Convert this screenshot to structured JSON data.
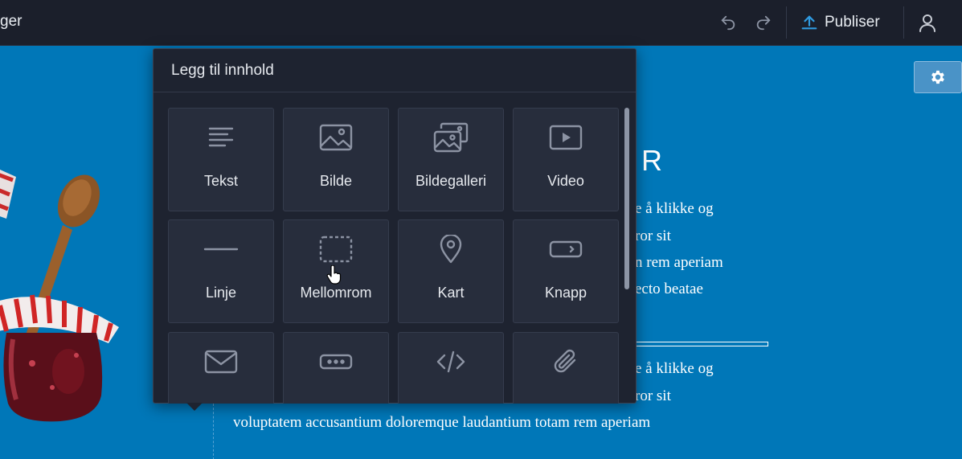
{
  "topbar": {
    "breadcrumb_fragment": "ger",
    "publish_label": "Publiser",
    "undo_icon": "undo-icon",
    "redo_icon": "redo-icon",
    "publish_icon": "upload-icon",
    "account_icon": "user-icon"
  },
  "canvas": {
    "heading_fragment": "R",
    "block1_lines": [
      "e å klikke og",
      "ror sit",
      "n rem aperiam",
      "ecto beatae"
    ],
    "block2_lines": [
      "e å klikke og",
      "ror sit",
      "voluptatem accusantium doloremque laudantium totam rem aperiam"
    ],
    "settings_icon": "gear-icon"
  },
  "popup": {
    "title": "Legg til innhold",
    "tiles": [
      {
        "label": "Tekst",
        "icon": "text-lines-icon"
      },
      {
        "label": "Bilde",
        "icon": "image-icon"
      },
      {
        "label": "Bildegalleri",
        "icon": "gallery-icon"
      },
      {
        "label": "Video",
        "icon": "video-icon"
      },
      {
        "label": "Linje",
        "icon": "line-icon"
      },
      {
        "label": "Mellomrom",
        "icon": "spacer-icon"
      },
      {
        "label": "Kart",
        "icon": "map-pin-icon"
      },
      {
        "label": "Knapp",
        "icon": "button-icon"
      },
      {
        "label": "",
        "icon": "mail-icon"
      },
      {
        "label": "",
        "icon": "form-field-icon"
      },
      {
        "label": "",
        "icon": "code-icon"
      },
      {
        "label": "",
        "icon": "paperclip-icon"
      }
    ]
  },
  "colors": {
    "topbar_bg": "#1b1f2b",
    "canvas_bg": "#0077b8",
    "popup_bg": "#1e2330",
    "tile_bg": "#272d3c",
    "accent": "#2f9ae0"
  }
}
